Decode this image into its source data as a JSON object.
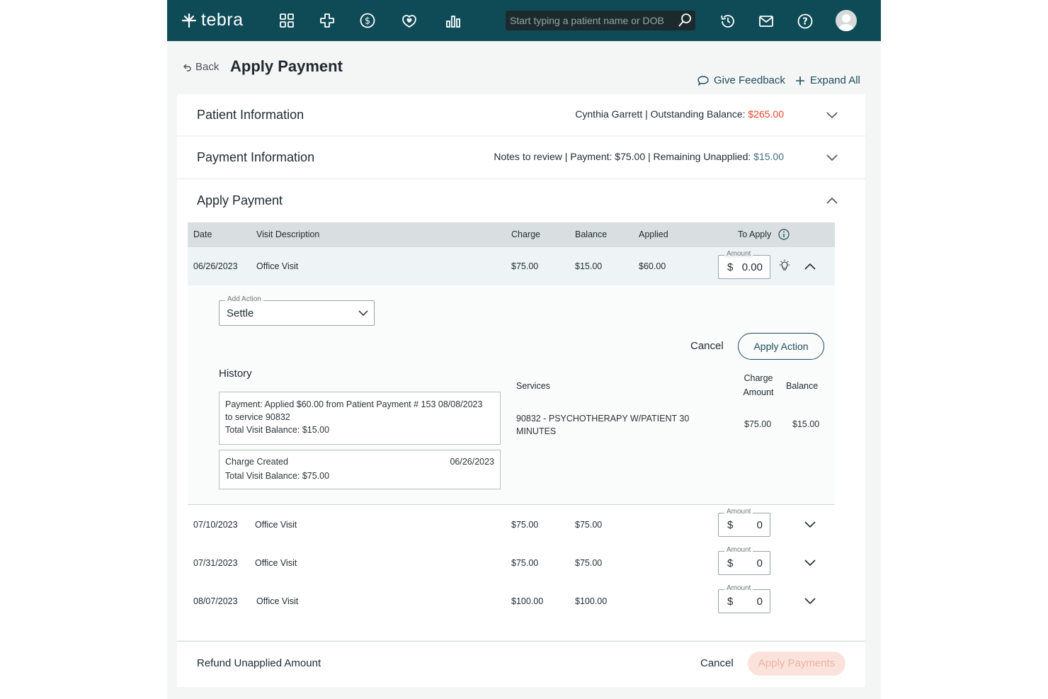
{
  "topbar": {
    "brand": "tebra",
    "search_placeholder": "Start typing a patient name or DOB"
  },
  "header": {
    "back_label": "Back",
    "title": "Apply Payment",
    "feedback_label": "Give Feedback",
    "expand_all_label": "Expand All"
  },
  "patient_section": {
    "title": "Patient Information",
    "summary_prefix": "Cynthia Garrett | Outstanding Balance: ",
    "balance": "$265.00"
  },
  "payment_section": {
    "title": "Payment Information",
    "summary_prefix": "Notes to review | Payment: $75.00 | Remaining Unapplied: ",
    "remaining": "$15.00"
  },
  "apply_section": {
    "title": "Apply Payment",
    "columns": {
      "date": "Date",
      "visit": "Visit Description",
      "charge": "Charge",
      "balance": "Balance",
      "applied": "Applied",
      "to_apply": "To Apply"
    },
    "amount_label": "Amount",
    "currency": "$",
    "rows": [
      {
        "date": "06/26/2023",
        "visit": "Office Visit",
        "charge": "$75.00",
        "balance": "$15.00",
        "applied": "$60.00",
        "amount": "0.00"
      },
      {
        "date": "07/10/2023",
        "visit": "Office Visit",
        "charge": "$75.00",
        "balance": "$75.00",
        "applied": "",
        "amount": "0"
      },
      {
        "date": "07/31/2023",
        "visit": "Office Visit",
        "charge": "$75.00",
        "balance": "$75.00",
        "applied": "",
        "amount": "0"
      },
      {
        "date": "08/07/2023",
        "visit": "Office Visit",
        "charge": "$100.00",
        "balance": "$100.00",
        "applied": "",
        "amount": "0"
      }
    ],
    "expanded": {
      "add_action_label": "Add Action",
      "add_action_value": "Settle",
      "cancel_label": "Cancel",
      "apply_action_label": "Apply Action",
      "history_title": "History",
      "history": [
        {
          "line1": "Payment: Applied $60.00 from Patient Payment # 153 08/08/2023",
          "line2": "to service 90832",
          "line3": "Total Visit Balance: $15.00"
        },
        {
          "line1": "Charge Created",
          "date": "06/26/2023",
          "line3": "Total Visit Balance: $75.00"
        }
      ],
      "services_header": "Services",
      "charge_amount_header_1": "Charge",
      "charge_amount_header_2": "Amount",
      "balance_header": "Balance",
      "service_line1": "90832 - PSYCHOTHERAPY W/PATIENT 30",
      "service_line2": "MINUTES",
      "service_charge": "$75.00",
      "service_balance": "$15.00"
    }
  },
  "footer": {
    "refund_label": "Refund Unapplied Amount",
    "cancel_label": "Cancel",
    "apply_payments_label": "Apply Payments"
  }
}
